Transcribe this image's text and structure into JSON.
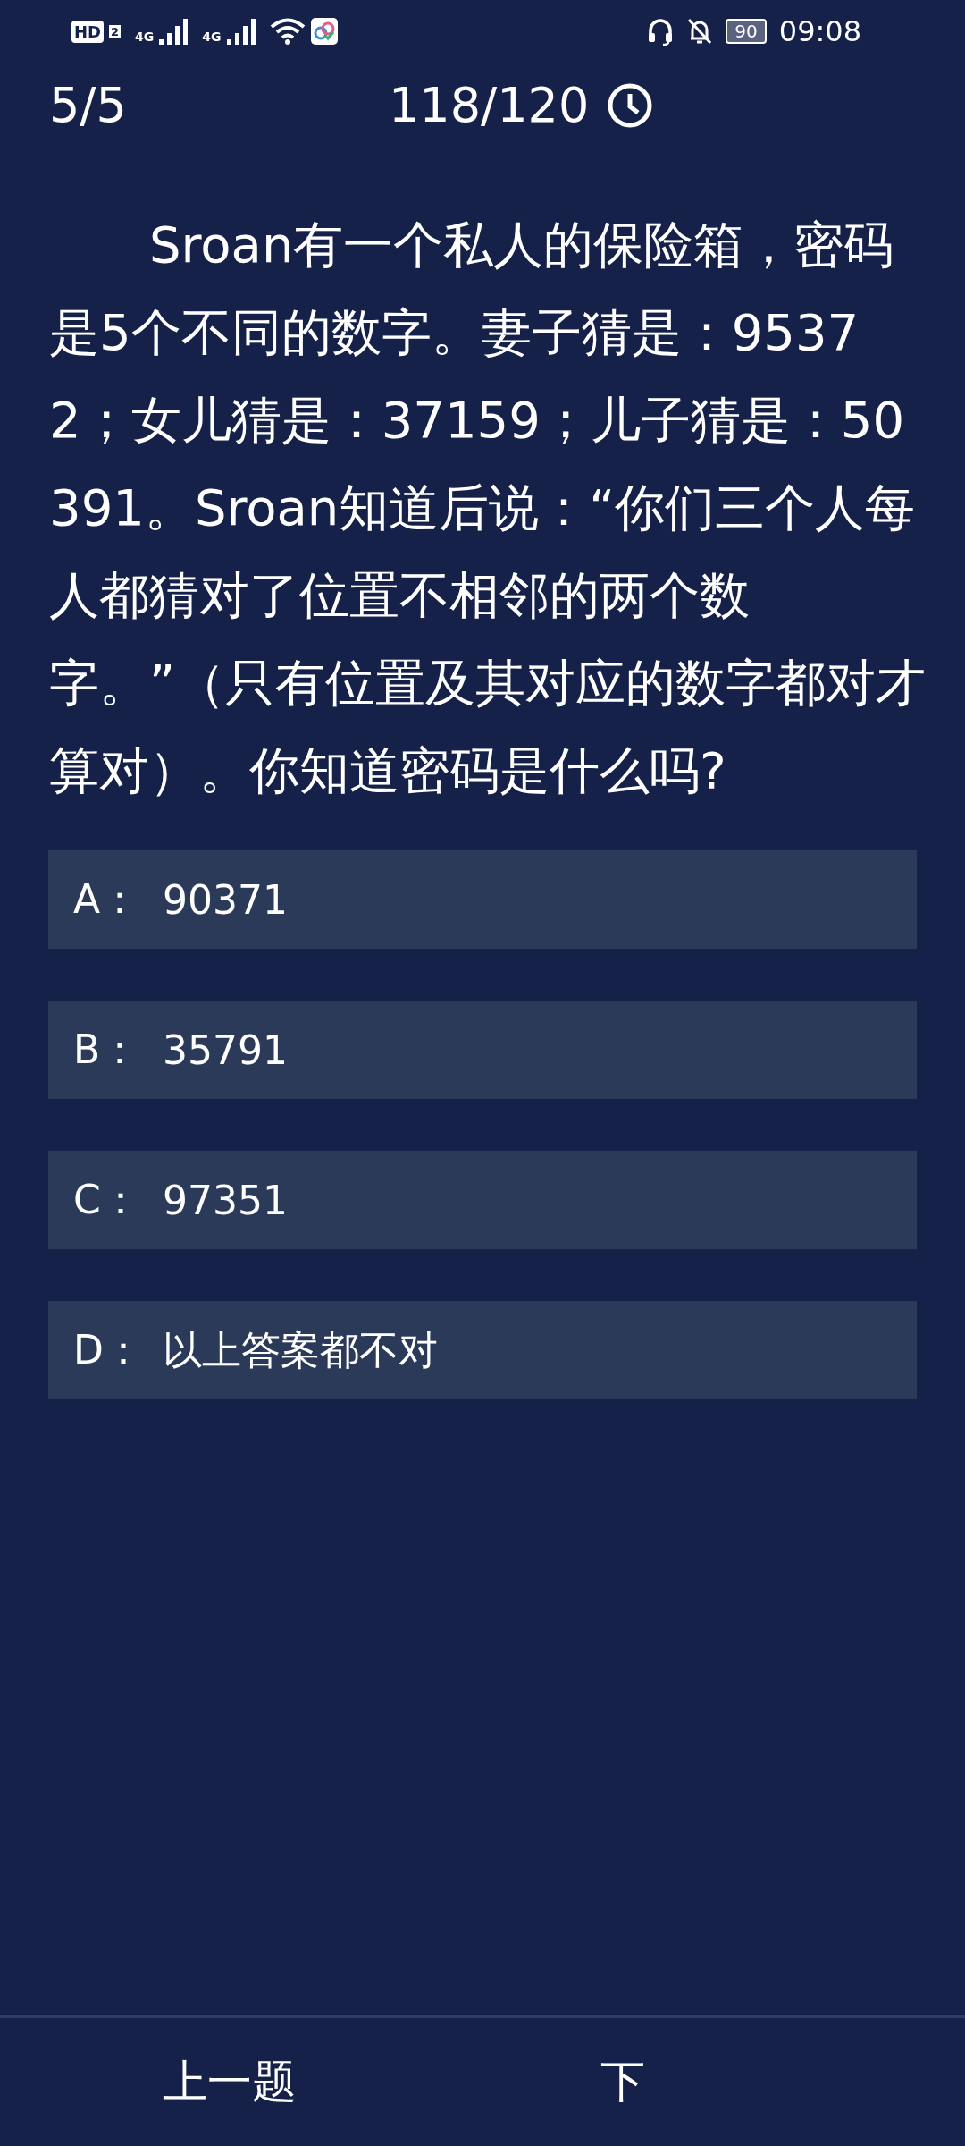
{
  "status_bar": {
    "hd_badge": "HD",
    "sim_number": "2",
    "networks": [
      "4G",
      "4G"
    ],
    "battery": "90",
    "time": "09:08"
  },
  "header": {
    "progress": "5/5",
    "timer": "118/120"
  },
  "question": "Sroan有一个私人的保险箱，密码是5个不同的数字。妻子猜是：95372；女儿猜是：37159；儿子猜是：50391。Sroan知道后说：“你们三个人每人都猜对了位置不相邻的两个数字。”（只有位置及其对应的数字都对才算对）。你知道密码是什么吗?",
  "options": [
    {
      "letter": "A：",
      "text": "90371",
      "selected": false
    },
    {
      "letter": "B：",
      "text": "35791",
      "selected": false
    },
    {
      "letter": "C：",
      "text": "97351",
      "selected": false
    },
    {
      "letter": "D：",
      "text": "以上答案都不对",
      "selected": false
    }
  ],
  "footer": {
    "prev": "上一题",
    "next": "下"
  }
}
